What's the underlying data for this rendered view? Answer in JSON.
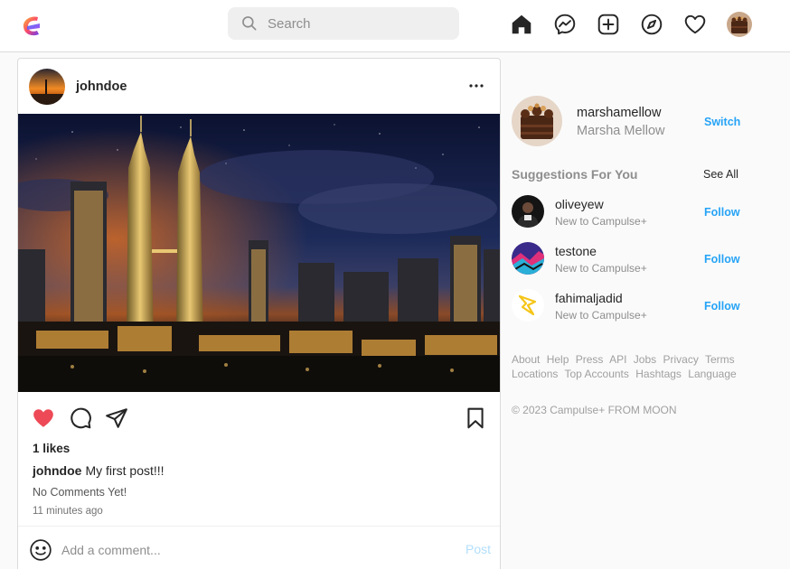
{
  "nav": {
    "search_placeholder": "Search",
    "icons": [
      "home-icon",
      "messenger-icon",
      "add-post-icon",
      "explore-icon",
      "heart-icon"
    ]
  },
  "post": {
    "username": "johndoe",
    "likes": "1 likes",
    "caption_user": "johndoe",
    "caption_text": "My first post!!!",
    "comments": "No Comments Yet!",
    "time": "11 minutes ago",
    "comment_placeholder": "Add a comment...",
    "post_label": "Post",
    "liked": true
  },
  "profile": {
    "username": "marshamellow",
    "name": "Marsha Mellow",
    "switch_label": "Switch"
  },
  "suggestions": {
    "title": "Suggestions For You",
    "see_all": "See All",
    "items": [
      {
        "username": "oliveyew",
        "sub": "New to Campulse+",
        "action": "Follow"
      },
      {
        "username": "testone",
        "sub": "New to Campulse+",
        "action": "Follow"
      },
      {
        "username": "fahimaljadid",
        "sub": "New to Campulse+",
        "action": "Follow"
      }
    ]
  },
  "footer": {
    "links": [
      "About",
      "Help",
      "Press",
      "API",
      "Jobs",
      "Privacy",
      "Terms",
      "Locations",
      "Top Accounts",
      "Hashtags",
      "Language"
    ],
    "copyright": "© 2023 Campulse+ FROM MOON"
  },
  "colors": {
    "accent": "#0095f6",
    "like": "#ed4956",
    "border": "#dbdbdb"
  }
}
